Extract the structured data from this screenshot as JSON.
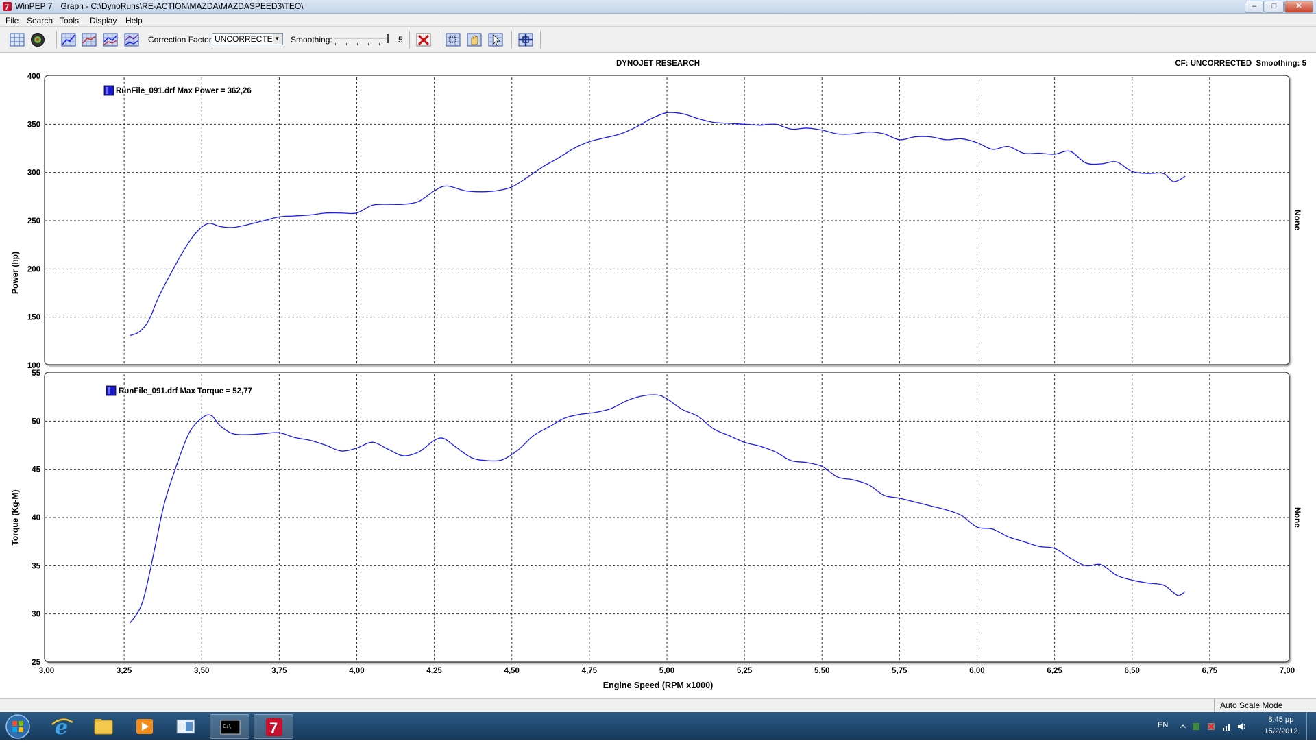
{
  "window": {
    "app_name": "WinPEP 7",
    "doc_title": "Graph - C:\\DynoRuns\\RE-ACTION\\MAZDA\\MAZDASPEED3\\TEO\\",
    "minimize": "–",
    "maximize": "□",
    "close": "✕"
  },
  "menu": [
    "File",
    "Search",
    "Tools",
    "Display",
    "Help"
  ],
  "toolbar": {
    "correction_label": "Correction Factor:",
    "correction_value": "UNCORRECTED",
    "smoothing_label": "Smoothing:",
    "smoothing_value": "5",
    "icons": [
      "grid-view-icon",
      "dyno-wheel-icon",
      "graph-1-icon",
      "graph-2-icon",
      "graph-3-icon",
      "graph-4-icon",
      "delete-run-icon",
      "zoom-grid-icon",
      "hand-pan-icon",
      "select-range-icon",
      "crosshair-icon"
    ]
  },
  "graph": {
    "header_center": "DYNOJET RESEARCH",
    "header_right": "CF: UNCORRECTED  Smoothing: 5",
    "xlabel": "Engine Speed (RPM x1000)",
    "x_ticks": [
      "3,00",
      "3,25",
      "3,50",
      "3,75",
      "4,00",
      "4,25",
      "4,50",
      "4,75",
      "5,00",
      "5,25",
      "5,50",
      "5,75",
      "6,00",
      "6,25",
      "6,50",
      "6,75",
      "7,00"
    ],
    "power_legend": "RunFile_091.drf Max Power = 362,26",
    "torque_legend": "RunFile_091.drf Max Torque = 52,77",
    "right_axis_label_top": "None",
    "right_axis_label_bottom": "None",
    "series_color": "#1a1aff",
    "legend_swatch_color": "#1a1acc"
  },
  "chart_data": [
    {
      "type": "line",
      "ylabel": "Power (hp)",
      "xlim": [
        3.0,
        7.0
      ],
      "ylim": [
        100,
        400
      ],
      "y_ticks": [
        "400",
        "350",
        "300",
        "250",
        "200",
        "150",
        "100"
      ],
      "grid": true,
      "legend_position": "top-left",
      "series": [
        {
          "name": "RunFile_091.drf",
          "x": [
            3.27,
            3.3,
            3.33,
            3.36,
            3.4,
            3.44,
            3.48,
            3.52,
            3.56,
            3.6,
            3.65,
            3.7,
            3.75,
            3.8,
            3.85,
            3.9,
            3.95,
            4.0,
            4.05,
            4.1,
            4.15,
            4.2,
            4.25,
            4.29,
            4.35,
            4.4,
            4.45,
            4.5,
            4.55,
            4.6,
            4.65,
            4.7,
            4.75,
            4.8,
            4.85,
            4.9,
            4.95,
            5.0,
            5.05,
            5.1,
            5.15,
            5.2,
            5.25,
            5.3,
            5.35,
            5.4,
            5.45,
            5.5,
            5.55,
            5.6,
            5.65,
            5.7,
            5.75,
            5.8,
            5.85,
            5.9,
            5.95,
            6.0,
            6.05,
            6.1,
            6.15,
            6.2,
            6.25,
            6.3,
            6.35,
            6.4,
            6.45,
            6.5,
            6.55,
            6.6,
            6.63,
            6.65,
            6.67
          ],
          "values": [
            131,
            135,
            147,
            170,
            195,
            218,
            237,
            247,
            244,
            243,
            246,
            250,
            254,
            255,
            256,
            258,
            258,
            258,
            266,
            267,
            267,
            270,
            281,
            286,
            281,
            280,
            281,
            285,
            295,
            306,
            315,
            325,
            332,
            336,
            340,
            347,
            356,
            362,
            361,
            356,
            352,
            351,
            350,
            349,
            350,
            345,
            346,
            344,
            340,
            340,
            342,
            340,
            334,
            337,
            337,
            334,
            335,
            331,
            324,
            327,
            320,
            320,
            319,
            322,
            310,
            309,
            311,
            301,
            299,
            299,
            291,
            292,
            296
          ]
        }
      ]
    },
    {
      "type": "line",
      "ylabel": "Torque (Kg-M)",
      "xlim": [
        3.0,
        7.0
      ],
      "ylim": [
        25,
        55
      ],
      "y_ticks": [
        "55",
        "50",
        "45",
        "40",
        "35",
        "30",
        "25"
      ],
      "grid": true,
      "legend_position": "top-left",
      "series": [
        {
          "name": "RunFile_091.drf",
          "x": [
            3.27,
            3.3,
            3.32,
            3.35,
            3.38,
            3.42,
            3.46,
            3.5,
            3.53,
            3.56,
            3.6,
            3.65,
            3.7,
            3.75,
            3.8,
            3.85,
            3.9,
            3.95,
            4.0,
            4.05,
            4.1,
            4.15,
            4.2,
            4.25,
            4.28,
            4.32,
            4.37,
            4.42,
            4.47,
            4.52,
            4.57,
            4.62,
            4.67,
            4.72,
            4.77,
            4.82,
            4.87,
            4.92,
            4.97,
            5.0,
            5.05,
            5.1,
            5.15,
            5.2,
            5.25,
            5.3,
            5.35,
            5.4,
            5.45,
            5.5,
            5.55,
            5.6,
            5.65,
            5.7,
            5.75,
            5.8,
            5.85,
            5.9,
            5.95,
            6.0,
            6.05,
            6.1,
            6.15,
            6.2,
            6.25,
            6.3,
            6.35,
            6.4,
            6.45,
            6.5,
            6.55,
            6.6,
            6.63,
            6.65,
            6.67
          ],
          "values": [
            29.1,
            30.5,
            32.5,
            37.0,
            41.5,
            45.5,
            48.8,
            50.3,
            50.6,
            49.5,
            48.7,
            48.6,
            48.7,
            48.8,
            48.3,
            48.0,
            47.5,
            46.9,
            47.2,
            47.8,
            47.1,
            46.4,
            46.8,
            48.0,
            48.2,
            47.3,
            46.2,
            45.9,
            46.0,
            47.0,
            48.5,
            49.4,
            50.3,
            50.7,
            50.9,
            51.3,
            52.1,
            52.6,
            52.7,
            52.3,
            51.2,
            50.5,
            49.2,
            48.5,
            47.8,
            47.4,
            46.8,
            45.9,
            45.7,
            45.3,
            44.2,
            43.9,
            43.4,
            42.3,
            42.0,
            41.6,
            41.2,
            40.8,
            40.2,
            39.0,
            38.8,
            38.0,
            37.5,
            37.0,
            36.8,
            35.8,
            35.0,
            35.1,
            34.0,
            33.5,
            33.2,
            33.0,
            32.3,
            31.9,
            32.3
          ]
        }
      ]
    }
  ],
  "status": {
    "right": "Auto Scale Mode"
  },
  "taskbar": {
    "lang": "EN",
    "time": "8:45 μμ",
    "date": "15/2/2012"
  }
}
